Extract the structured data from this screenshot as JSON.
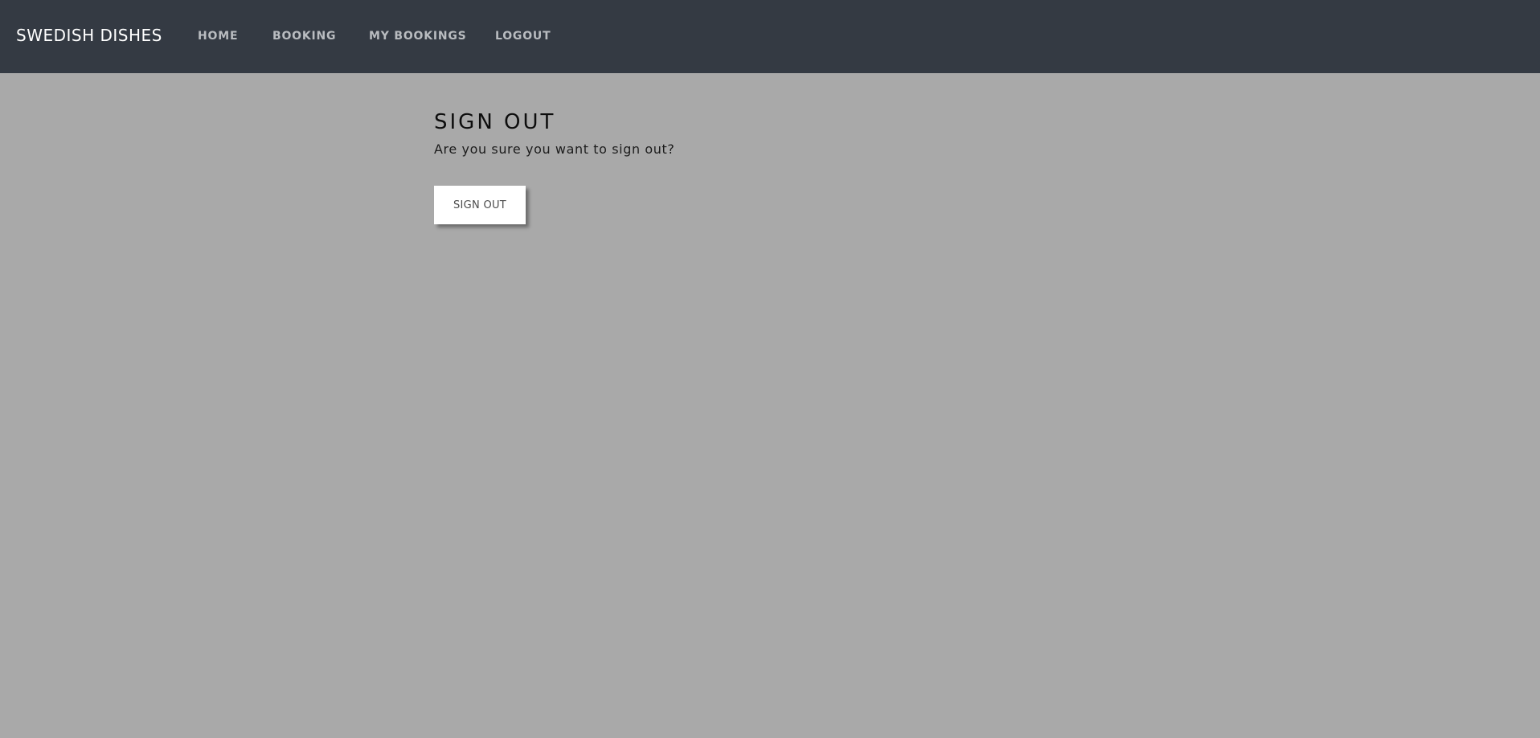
{
  "navbar": {
    "brand": "SWEDISH DISHES",
    "links": [
      {
        "label": "HOME"
      },
      {
        "label": "BOOKING"
      },
      {
        "label": "MY BOOKINGS"
      },
      {
        "label": "LOGOUT"
      }
    ]
  },
  "main": {
    "title": "SIGN OUT",
    "message": "Are you sure you want to sign out?",
    "button_label": "SIGN OUT"
  },
  "colors": {
    "navbar_bg": "#343a43",
    "page_bg": "#a9a9a9",
    "button_bg": "#ffffff"
  }
}
